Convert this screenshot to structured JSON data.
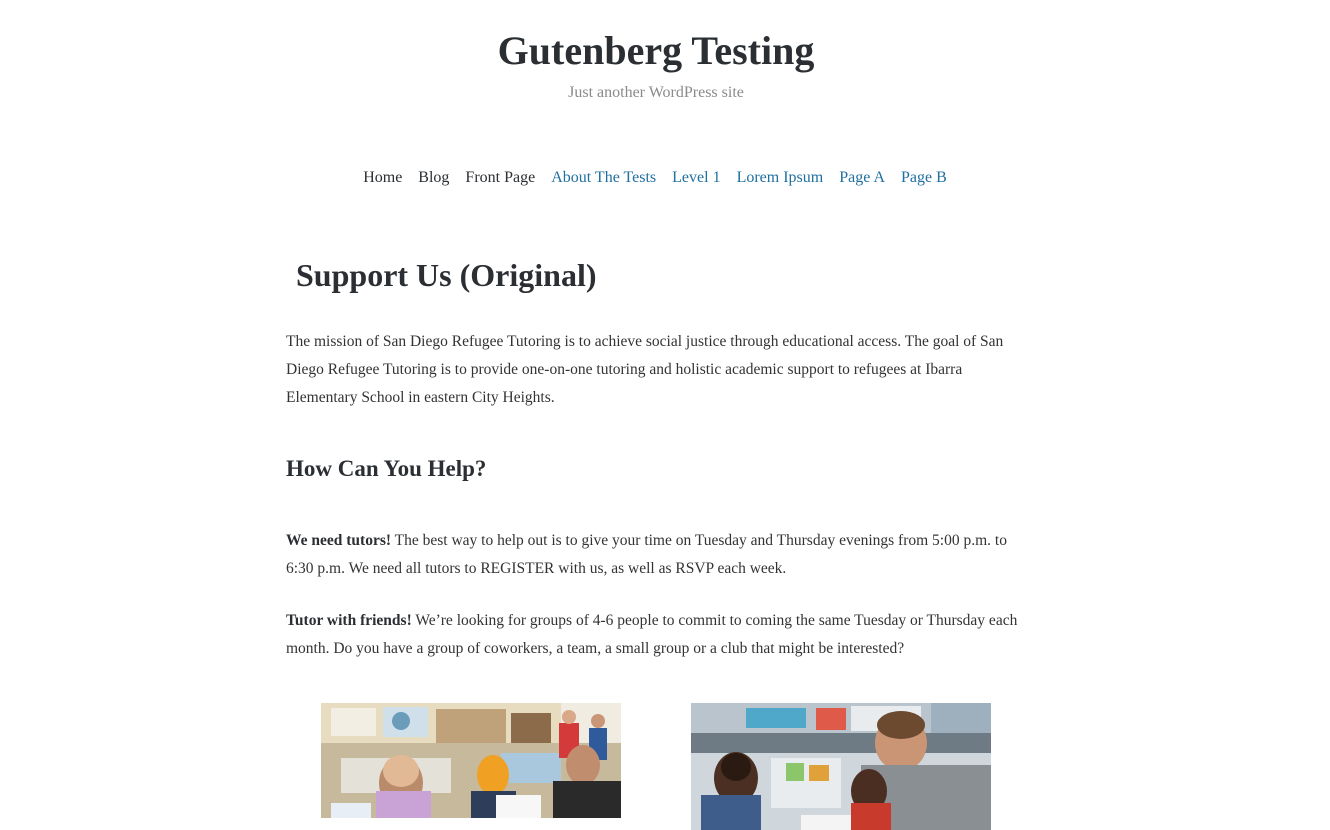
{
  "site": {
    "title": "Gutenberg Testing",
    "tagline": "Just another WordPress site"
  },
  "nav": {
    "items": [
      {
        "label": "Home",
        "color": "#2b2f33"
      },
      {
        "label": "Blog",
        "color": "#2b2f33"
      },
      {
        "label": "Front Page",
        "color": "#2b2f33"
      },
      {
        "label": "About The Tests",
        "color": "#1f6f9f"
      },
      {
        "label": "Level 1",
        "color": "#1f6f9f"
      },
      {
        "label": "Lorem Ipsum",
        "color": "#1f6f9f"
      },
      {
        "label": "Page A",
        "color": "#1f6f9f"
      },
      {
        "label": "Page B",
        "color": "#1f6f9f"
      }
    ]
  },
  "page": {
    "title": "Support Us (Original)",
    "intro": "The mission of San Diego Refugee Tutoring is to achieve social justice through educational access. The goal of San Diego Refugee Tutoring is to provide one-on-one tutoring and holistic academic support to refugees at Ibarra Elementary School in eastern City Heights.",
    "help_heading": "How Can You Help?",
    "tutors_bold": "We need tutors!",
    "tutors_text": " The best way to help out is to give your time on Tuesday and Thursday evenings from 5:00 p.m. to 6:30 p.m. We need all tutors to REGISTER with us, as well as RSVP each week.",
    "friends_bold": "Tutor with friends!",
    "friends_text": " We’re looking for groups of 4-6 people to commit to coming the same Tuesday or Thursday each month. Do you have a group of coworkers, a team, a small group or a club that might be interested?"
  },
  "colors": {
    "title": "#2b2f33",
    "tagline": "#8a8a8a",
    "link": "#1f6f9f"
  }
}
